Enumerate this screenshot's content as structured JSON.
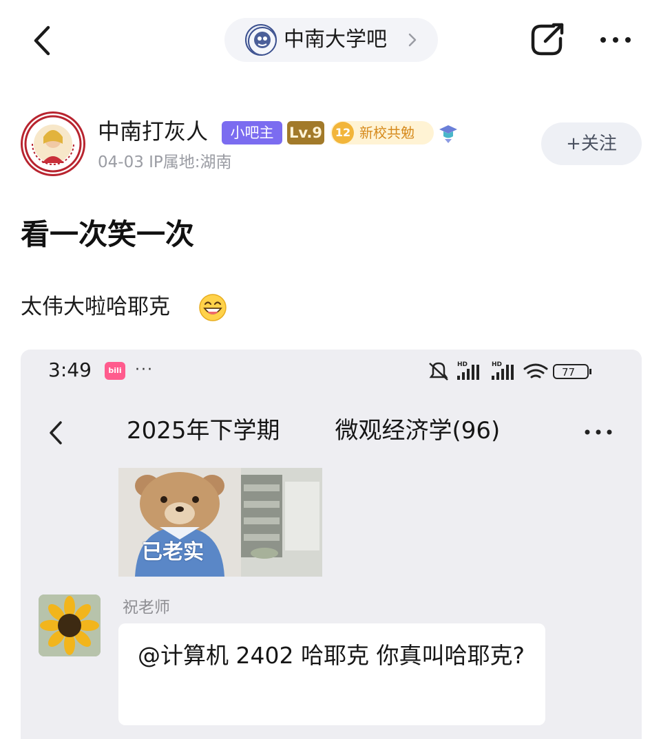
{
  "header": {
    "forum_name": "中南大学吧",
    "back_icon": "chevron-left-icon",
    "share_icon": "share-icon",
    "more_icon": "more-horizontal-icon"
  },
  "author": {
    "name": "中南打灰人",
    "badge_admin": "小吧主",
    "badge_level": "Lv.9",
    "school_badge_number": "12",
    "school_badge_label": "新校共勉",
    "post_meta": "04-03  IP属地:湖南",
    "follow_label": "+关注"
  },
  "post": {
    "title": "看一次笑一次",
    "body": "太伟大啦哈耶克",
    "emoji": "grinning-face-emoji"
  },
  "screenshot": {
    "status_time": "3:49",
    "app_icon_label": "bili",
    "status_dots": "···",
    "battery": "77",
    "chat_title_part1": "2025年下学期",
    "chat_title_part2": "微观经济学(96)",
    "sticker_caption": "已老实",
    "sender_name": "祝老师",
    "message": "@计算机 2402 哈耶克  你真叫哈耶克?"
  },
  "colors": {
    "badge_admin": "#7b6cf0",
    "badge_level": "#a27a2a",
    "school_badge": "#f2b53a",
    "follow_bg": "#eef0f5",
    "screenshot_bg": "#eeeef2"
  }
}
